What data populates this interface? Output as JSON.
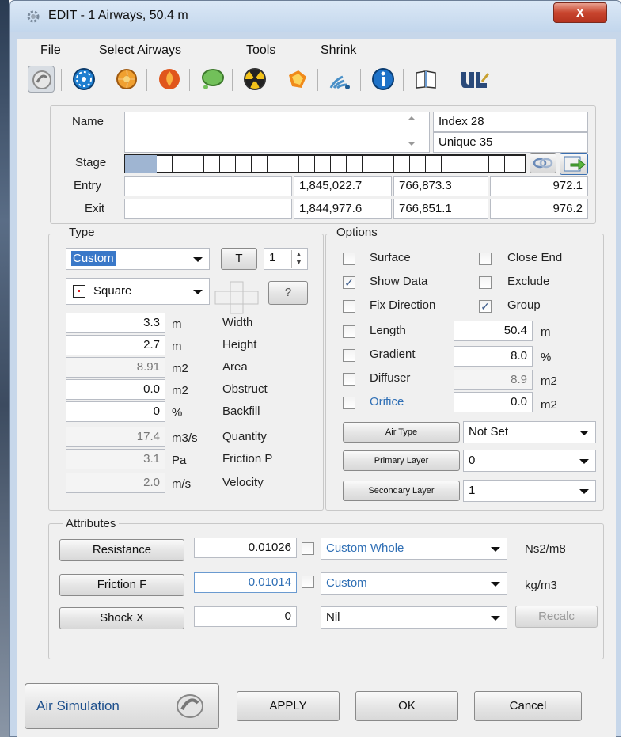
{
  "window": {
    "title": "EDIT -  1 Airways, 50.4 m",
    "close_symbol": "x"
  },
  "menu": [
    "File",
    "Select Airways",
    "Tools",
    "Shrink"
  ],
  "toolbar_icons": [
    "airway-select-icon",
    "fan-icon",
    "regulator-icon",
    "fire-icon",
    "gas-icon",
    "radiation-icon",
    "heat-icon",
    "signal-icon",
    "info-icon",
    "book-icon",
    "logo-icon"
  ],
  "header": {
    "name_label": "Name",
    "name_value": "",
    "index": "Index 28",
    "unique": "Unique 35",
    "stage_label": "Stage",
    "entry_label": "Entry",
    "exit_label": "Exit",
    "entry": {
      "name": "",
      "x": "1,845,022.7",
      "y": "766,873.3",
      "z": "972.1"
    },
    "exit": {
      "name": "",
      "x": "1,844,977.6",
      "y": "766,851.1",
      "z": "976.2"
    }
  },
  "type": {
    "title": "Type",
    "type_value": "Custom",
    "t_button": "T",
    "spin_value": "1",
    "shape_value": "Square",
    "help_button": "?",
    "rows": [
      {
        "value": "3.3",
        "unit": "m",
        "label": "Width",
        "disabled": false
      },
      {
        "value": "2.7",
        "unit": "m",
        "label": "Height",
        "disabled": false
      },
      {
        "value": "8.91",
        "unit": "m2",
        "label": "Area",
        "disabled": true
      },
      {
        "value": "0.0",
        "unit": "m2",
        "label": "Obstruct",
        "disabled": false
      },
      {
        "value": "0",
        "unit": "%",
        "label": "Backfill",
        "disabled": false
      },
      {
        "value": "17.4",
        "unit": "m3/s",
        "label": "Quantity",
        "disabled": true
      },
      {
        "value": "3.1",
        "unit": "Pa",
        "label": "Friction P",
        "disabled": true
      },
      {
        "value": "2.0",
        "unit": "m/s",
        "label": "Velocity",
        "disabled": true
      }
    ]
  },
  "options": {
    "title": "Options",
    "surface": "Surface",
    "close_end": "Close End",
    "show_data": "Show Data",
    "exclude": "Exclude",
    "fix_direction": "Fix Direction",
    "group": "Group",
    "length_label": "Length",
    "length_value": "50.4",
    "length_unit": "m",
    "gradient_label": "Gradient",
    "gradient_value": "8.0",
    "gradient_unit": "%",
    "diffuser_label": "Diffuser",
    "diffuser_value": "8.9",
    "diffuser_unit": "m2",
    "orifice_label": "Orifice",
    "orifice_value": "0.0",
    "orifice_unit": "m2",
    "air_type_button": "Air Type",
    "air_type_value": "Not Set",
    "primary_layer_button": "Primary Layer",
    "primary_layer_value": "0",
    "secondary_layer_button": "Secondary Layer",
    "secondary_layer_value": "1",
    "checked": {
      "surface": false,
      "close_end": false,
      "show_data": true,
      "exclude": false,
      "fix_direction": false,
      "group": true,
      "length": false,
      "gradient": false,
      "diffuser": false,
      "orifice": false
    }
  },
  "attributes": {
    "title": "Attributes",
    "resistance_button": "Resistance",
    "resistance_value": "0.01026",
    "resistance_mode": "Custom Whole",
    "resistance_unit": "Ns2/m8",
    "friction_button": "Friction F",
    "friction_value": "0.01014",
    "friction_mode": "Custom",
    "friction_unit": "kg/m3",
    "shock_button": "Shock X",
    "shock_value": "0",
    "shock_mode": "Nil",
    "recalc_button": "Recalc"
  },
  "footer": {
    "air_simulation": "Air Simulation",
    "apply": "APPLY",
    "ok": "OK",
    "cancel": "Cancel"
  },
  "colors": {
    "accent_blue": "#2f6fb5",
    "selection": "#3a78c8",
    "title_bar": "#c2d6ec",
    "close_red": "#c8452e"
  }
}
